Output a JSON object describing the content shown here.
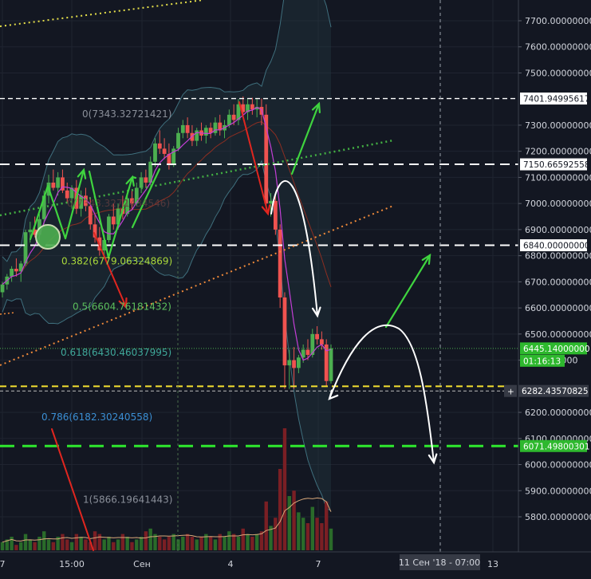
{
  "chart_data": {
    "type": "candlestick",
    "y_range": [
      5760,
      7800
    ],
    "y_ticks": [
      {
        "value": 7700,
        "label": "7700.00000000"
      },
      {
        "value": 7600,
        "label": "7600.00000000"
      },
      {
        "value": 7500,
        "label": "7500.00000000"
      },
      {
        "value": 7300,
        "label": "7300.00000000"
      },
      {
        "value": 7200,
        "label": "7200.00000000"
      },
      {
        "value": 7100,
        "label": "7100.00000000"
      },
      {
        "value": 7000,
        "label": "7000.00000000"
      },
      {
        "value": 6900,
        "label": "6900.00000000"
      },
      {
        "value": 6800,
        "label": "6800.00000000"
      },
      {
        "value": 6700,
        "label": "6700.00000000"
      },
      {
        "value": 6600,
        "label": "6600.00000000"
      },
      {
        "value": 6500,
        "label": "6500.00000000"
      },
      {
        "value": 6400,
        "label": "6400.00000"
      },
      {
        "value": 6200,
        "label": "6200.00000000"
      },
      {
        "value": 6100,
        "label": "6100.00000000"
      },
      {
        "value": 6000,
        "label": "6000.00000000"
      },
      {
        "value": 5900,
        "label": "5900.00000000"
      },
      {
        "value": 5800,
        "label": "5800.00000000"
      }
    ],
    "x_ticks": [
      {
        "x": 3,
        "label": "7"
      },
      {
        "x": 90,
        "label": "15:00"
      },
      {
        "x": 178,
        "label": "Сен"
      },
      {
        "x": 289,
        "label": "4"
      },
      {
        "x": 399,
        "label": "7"
      },
      {
        "x": 618,
        "label": "13"
      }
    ],
    "crosshair_time": "11 Сен '18 - 07:00",
    "price_tags": [
      {
        "value": 7402,
        "label": "7401.94995617",
        "style": "white"
      },
      {
        "value": 7150,
        "label": "7150.66592558",
        "style": "white"
      },
      {
        "value": 6840,
        "label": "6840.00000000",
        "style": "white"
      },
      {
        "value": 6445,
        "label": "6445.14000000",
        "style": "green"
      },
      {
        "value": 6282,
        "label": "6282.43570825",
        "style": "crosshair"
      },
      {
        "value": 6071,
        "label": "6071.49800301",
        "style": "green"
      }
    ],
    "countdown": "01:16:13",
    "fib_levels": [
      {
        "label": "0(7343.32721421)",
        "value": 7343,
        "color": "#8a8f99"
      },
      {
        "label": "0.382(6779.06324869)",
        "value": 6779,
        "color": "#a9d83a"
      },
      {
        "label": "0.5(6604.76181432)",
        "value": 6605,
        "color": "#5cbf5c"
      },
      {
        "label": "0.618(6430.46037995)",
        "value": 6430,
        "color": "#3fa89a"
      },
      {
        "label": "0.786(6182.30240558)",
        "value": 6182,
        "color": "#3b8fd4"
      },
      {
        "label": "1(5866.19641443)",
        "value": 5866,
        "color": "#8a8f99"
      }
    ],
    "fib_partial_labels": [
      "0(7343.3272",
      "1434546)"
    ],
    "candles": [
      {
        "o": 6660,
        "h": 6700,
        "l": 6640,
        "c": 6690
      },
      {
        "o": 6690,
        "h": 6730,
        "l": 6670,
        "c": 6720
      },
      {
        "o": 6720,
        "h": 6760,
        "l": 6700,
        "c": 6750
      },
      {
        "o": 6750,
        "h": 6790,
        "l": 6720,
        "c": 6740
      },
      {
        "o": 6740,
        "h": 6780,
        "l": 6700,
        "c": 6770
      },
      {
        "o": 6770,
        "h": 6900,
        "l": 6760,
        "c": 6890
      },
      {
        "o": 6890,
        "h": 6930,
        "l": 6850,
        "c": 6900
      },
      {
        "o": 6900,
        "h": 6950,
        "l": 6870,
        "c": 6880
      },
      {
        "o": 6880,
        "h": 6960,
        "l": 6860,
        "c": 6940
      },
      {
        "o": 6940,
        "h": 7050,
        "l": 6920,
        "c": 7030
      },
      {
        "o": 7030,
        "h": 7110,
        "l": 7000,
        "c": 7080
      },
      {
        "o": 7080,
        "h": 7130,
        "l": 7050,
        "c": 7060
      },
      {
        "o": 7060,
        "h": 7120,
        "l": 7030,
        "c": 7100
      },
      {
        "o": 7100,
        "h": 7130,
        "l": 7040,
        "c": 7050
      },
      {
        "o": 7050,
        "h": 7080,
        "l": 7000,
        "c": 7020
      },
      {
        "o": 7020,
        "h": 7070,
        "l": 6980,
        "c": 7060
      },
      {
        "o": 7060,
        "h": 7090,
        "l": 6960,
        "c": 6980
      },
      {
        "o": 6980,
        "h": 7050,
        "l": 6950,
        "c": 7030
      },
      {
        "o": 7030,
        "h": 7060,
        "l": 6970,
        "c": 6990
      },
      {
        "o": 6990,
        "h": 7020,
        "l": 6900,
        "c": 6920
      },
      {
        "o": 6920,
        "h": 6960,
        "l": 6850,
        "c": 6870
      },
      {
        "o": 6870,
        "h": 6910,
        "l": 6800,
        "c": 6820
      },
      {
        "o": 6820,
        "h": 6880,
        "l": 6790,
        "c": 6860
      },
      {
        "o": 6860,
        "h": 6960,
        "l": 6850,
        "c": 6950
      },
      {
        "o": 6950,
        "h": 7000,
        "l": 6900,
        "c": 6920
      },
      {
        "o": 6920,
        "h": 7000,
        "l": 6900,
        "c": 6980
      },
      {
        "o": 6980,
        "h": 7030,
        "l": 6940,
        "c": 6960
      },
      {
        "o": 6960,
        "h": 7040,
        "l": 6950,
        "c": 7020
      },
      {
        "o": 7020,
        "h": 7050,
        "l": 6980,
        "c": 7000
      },
      {
        "o": 7000,
        "h": 7080,
        "l": 6990,
        "c": 7060
      },
      {
        "o": 7060,
        "h": 7120,
        "l": 7040,
        "c": 7100
      },
      {
        "o": 7100,
        "h": 7130,
        "l": 7060,
        "c": 7080
      },
      {
        "o": 7080,
        "h": 7180,
        "l": 7070,
        "c": 7160
      },
      {
        "o": 7160,
        "h": 7250,
        "l": 7140,
        "c": 7230
      },
      {
        "o": 7230,
        "h": 7280,
        "l": 7190,
        "c": 7210
      },
      {
        "o": 7210,
        "h": 7250,
        "l": 7170,
        "c": 7190
      },
      {
        "o": 7190,
        "h": 7230,
        "l": 7130,
        "c": 7150
      },
      {
        "o": 7150,
        "h": 7220,
        "l": 7140,
        "c": 7210
      },
      {
        "o": 7210,
        "h": 7290,
        "l": 7200,
        "c": 7270
      },
      {
        "o": 7270,
        "h": 7320,
        "l": 7250,
        "c": 7300
      },
      {
        "o": 7300,
        "h": 7330,
        "l": 7250,
        "c": 7270
      },
      {
        "o": 7270,
        "h": 7300,
        "l": 7220,
        "c": 7240
      },
      {
        "o": 7240,
        "h": 7290,
        "l": 7220,
        "c": 7280
      },
      {
        "o": 7280,
        "h": 7310,
        "l": 7240,
        "c": 7260
      },
      {
        "o": 7260,
        "h": 7300,
        "l": 7230,
        "c": 7290
      },
      {
        "o": 7290,
        "h": 7310,
        "l": 7250,
        "c": 7270
      },
      {
        "o": 7270,
        "h": 7330,
        "l": 7260,
        "c": 7310
      },
      {
        "o": 7310,
        "h": 7340,
        "l": 7260,
        "c": 7280
      },
      {
        "o": 7280,
        "h": 7320,
        "l": 7250,
        "c": 7300
      },
      {
        "o": 7300,
        "h": 7360,
        "l": 7290,
        "c": 7340
      },
      {
        "o": 7340,
        "h": 7380,
        "l": 7300,
        "c": 7320
      },
      {
        "o": 7320,
        "h": 7400,
        "l": 7300,
        "c": 7380
      },
      {
        "o": 7380,
        "h": 7410,
        "l": 7330,
        "c": 7350
      },
      {
        "o": 7350,
        "h": 7400,
        "l": 7320,
        "c": 7380
      },
      {
        "o": 7380,
        "h": 7405,
        "l": 7340,
        "c": 7360
      },
      {
        "o": 7360,
        "h": 7400,
        "l": 7330,
        "c": 7370
      },
      {
        "o": 7370,
        "h": 7402,
        "l": 7300,
        "c": 7340
      },
      {
        "o": 7340,
        "h": 7380,
        "l": 6980,
        "c": 7000
      },
      {
        "o": 7000,
        "h": 7040,
        "l": 6950,
        "c": 7010
      },
      {
        "o": 7010,
        "h": 7030,
        "l": 6880,
        "c": 6900
      },
      {
        "o": 6900,
        "h": 6920,
        "l": 6600,
        "c": 6640
      },
      {
        "o": 6640,
        "h": 6660,
        "l": 6290,
        "c": 6380
      },
      {
        "o": 6380,
        "h": 6440,
        "l": 6290,
        "c": 6400
      },
      {
        "o": 6400,
        "h": 6450,
        "l": 6290,
        "c": 6370
      },
      {
        "o": 6370,
        "h": 6420,
        "l": 6350,
        "c": 6410
      },
      {
        "o": 6410,
        "h": 6460,
        "l": 6390,
        "c": 6440
      },
      {
        "o": 6440,
        "h": 6480,
        "l": 6400,
        "c": 6420
      },
      {
        "o": 6420,
        "h": 6520,
        "l": 6410,
        "c": 6500
      },
      {
        "o": 6500,
        "h": 6530,
        "l": 6460,
        "c": 6480
      },
      {
        "o": 6480,
        "h": 6510,
        "l": 6440,
        "c": 6460
      },
      {
        "o": 6460,
        "h": 6480,
        "l": 6300,
        "c": 6320
      },
      {
        "o": 6320,
        "h": 6460,
        "l": 6310,
        "c": 6445
      }
    ]
  }
}
